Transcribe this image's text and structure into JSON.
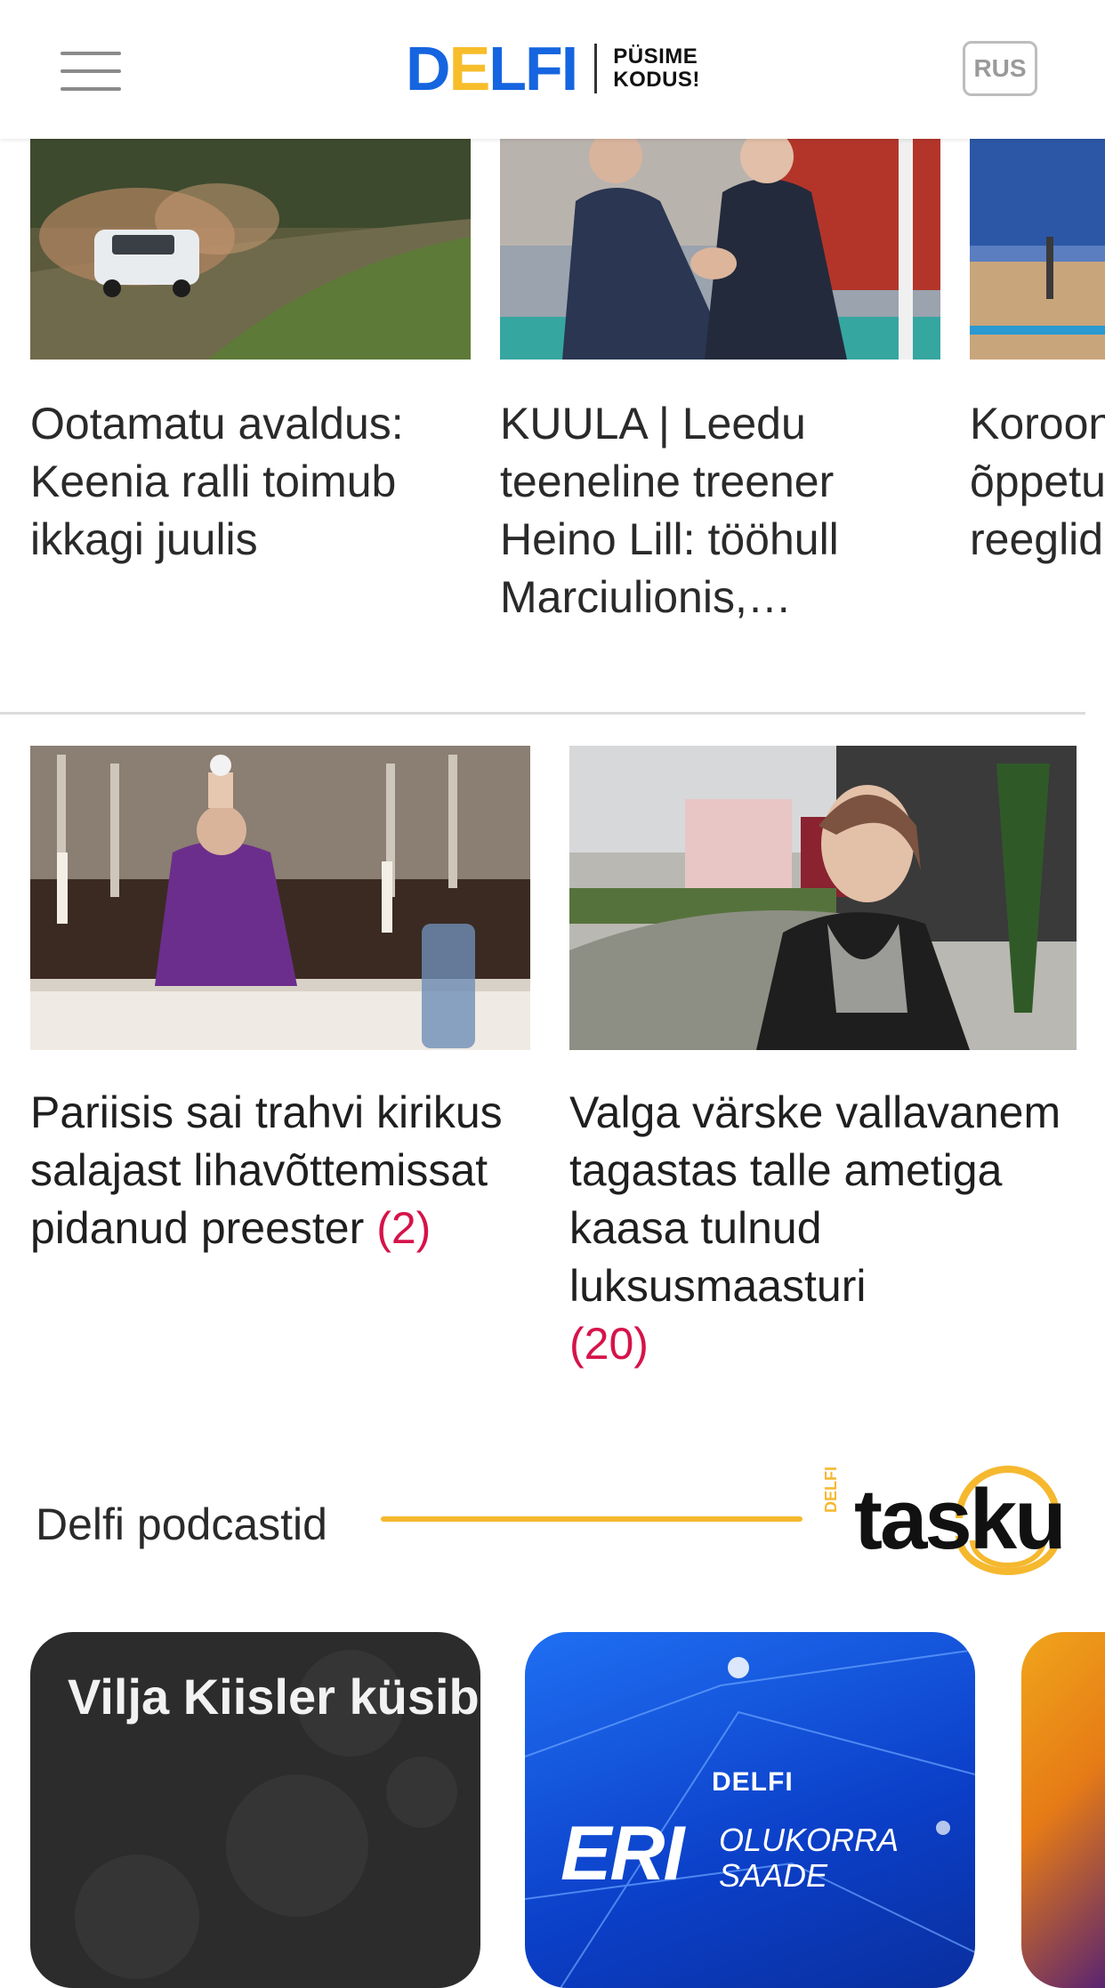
{
  "header": {
    "logo": {
      "letters": [
        "D",
        "E",
        "L",
        "F",
        "I"
      ],
      "letter_colors": [
        "#1565e0",
        "#f7bd2a",
        "#1565e0",
        "#1565e0",
        "#1565e0"
      ],
      "tagline_1": "PÜSIME",
      "tagline_2": "KODUS!"
    },
    "menu_icon": "hamburger-menu-icon",
    "lang_button": "RUS"
  },
  "top_carousel": [
    {
      "title": "Ootamatu avaldus: Keenia ralli toimub ikkagi juulis",
      "image": "rally-car-photo"
    },
    {
      "title": "KUULA | Leedu teeneline treener Heino Lill: tööhull Marciulionis, legendaarne …",
      "image": "coaches-handshake-photo"
    },
    {
      "title": "Koroonaviiruse õppetund: sporditeel reeglid",
      "image": "basketball-arena-photo"
    }
  ],
  "articles": [
    {
      "title": "Pariisis sai trahvi kirikus salajast lihavõttemissat pidanud preester",
      "comments": "(2)",
      "image": "priest-mass-photo"
    },
    {
      "title": "Valga värske vallavanem tagastas talle ametiga kaasa tulnud luksusmaasturi",
      "comments": "(20)",
      "image": "woman-portrait-photo"
    }
  ],
  "podcasts": {
    "section_title": "Delfi podcastid",
    "brand": {
      "word": "tasku",
      "prefix": "DELFI"
    },
    "accent_color": "#f5b82e",
    "items": [
      {
        "name": "Vilja Kiisler küsib"
      },
      {
        "brand": "DELFI",
        "big": "ERI",
        "sub_1": "OLUKORRA",
        "sub_2": "SAADE"
      },
      {
        "partial": true
      }
    ]
  }
}
